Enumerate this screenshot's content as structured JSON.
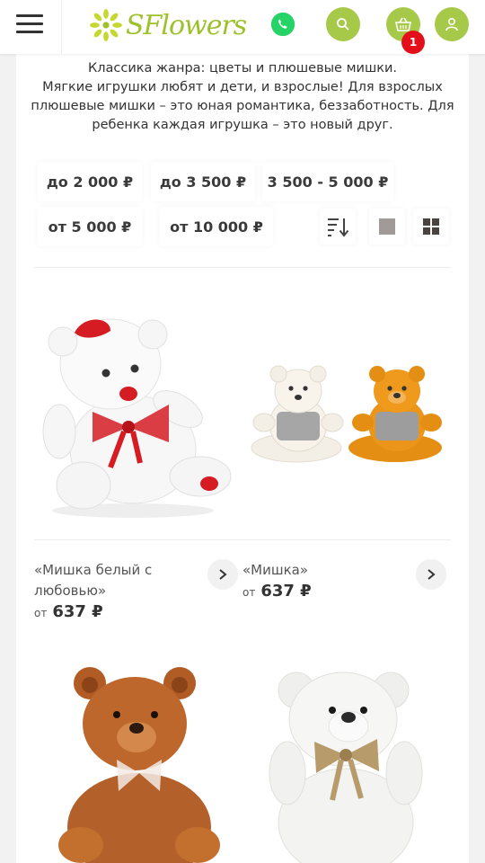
{
  "header": {
    "logo_text": "SFlowers",
    "cart_count": "1",
    "colors": {
      "accent": "#a7c94a",
      "badge": "#e3101b",
      "whatsapp": "#25d366"
    }
  },
  "intro": {
    "line1": "Классика жанра: цветы и плюшевые мишки.",
    "line2": "Мягкие игрушки любят и дети, и взрослые! Для взрослых плюшевые мишки – это юная романтика, беззаботность. Для ребенка каждая игрушка – это новый друг."
  },
  "filters": {
    "f1": "до 2 000 ₽",
    "f2": "до 3 500 ₽",
    "f3": "3 500 - 5 000 ₽",
    "f4": "от 5 000 ₽",
    "f5": "от 10 000 ₽"
  },
  "products": [
    {
      "name": "«Мишка белый с любовью»",
      "price_prefix": "от",
      "price": "637 ₽"
    },
    {
      "name": "«Мишка»",
      "price_prefix": "от",
      "price": "637 ₽"
    }
  ]
}
